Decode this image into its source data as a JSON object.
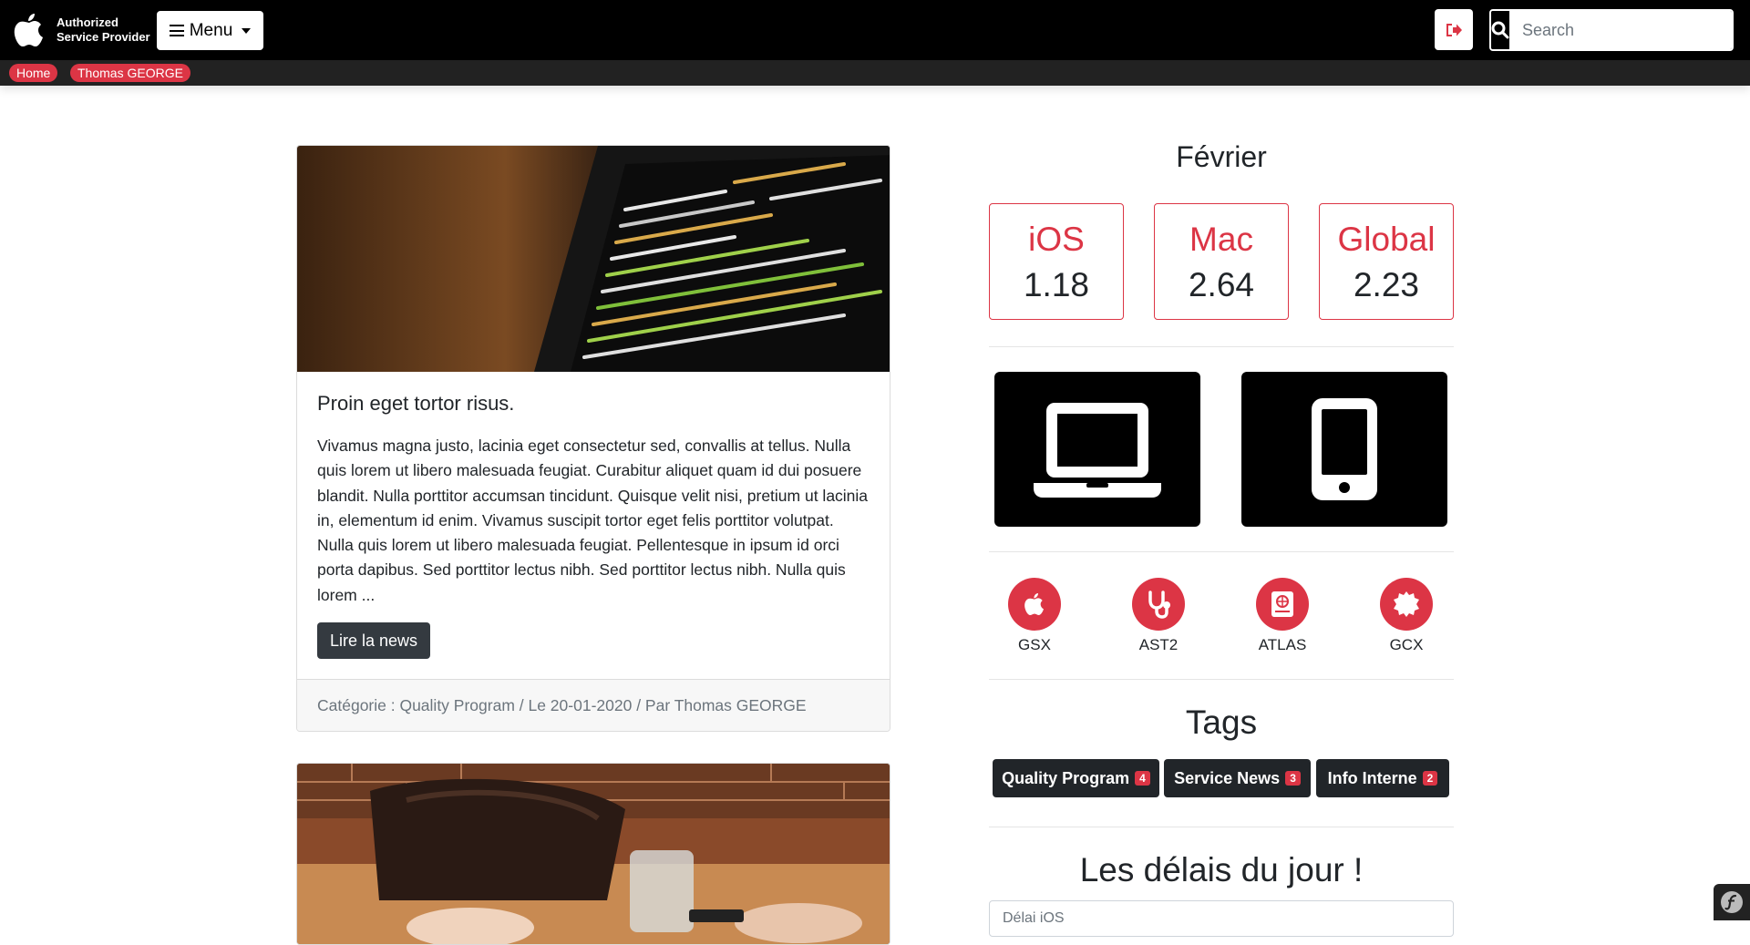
{
  "navbar": {
    "brand_line1": "Authorized",
    "brand_line2": "Service Provider",
    "menu_label": "Menu",
    "search_placeholder": "Search"
  },
  "breadcrumb": [
    "Home",
    "Thomas GEORGE"
  ],
  "news": [
    {
      "title": "Proin eget tortor risus.",
      "excerpt": "Vivamus magna justo, lacinia eget consectetur sed, convallis at tellus. Nulla quis lorem ut libero malesuada feugiat. Curabitur aliquet quam id dui posuere blandit. Nulla porttitor accumsan tincidunt. Quisque velit nisi, pretium ut lacinia in, elementum id enim. Vivamus suscipit tortor eget felis porttitor volutpat. Nulla quis lorem ut libero malesuada feugiat. Pellentesque in ipsum id orci porta dapibus. Sed porttitor lectus nibh. Sed porttitor lectus nibh. Nulla quis lorem ...",
      "button": "Lire la news",
      "footer": "Catégorie : Quality Program / Le 20-01-2020 / Par Thomas GEORGE"
    }
  ],
  "stats": {
    "month": "Février",
    "items": [
      {
        "label": "iOS",
        "value": "1.18"
      },
      {
        "label": "Mac",
        "value": "2.64"
      },
      {
        "label": "Global",
        "value": "2.23"
      }
    ]
  },
  "tools": [
    "GSX",
    "AST2",
    "ATLAS",
    "GCX"
  ],
  "tags": {
    "title": "Tags",
    "items": [
      {
        "label": "Quality Program",
        "count": "4"
      },
      {
        "label": "Service News",
        "count": "3"
      },
      {
        "label": "Info Interne",
        "count": "2"
      }
    ]
  },
  "delays": {
    "title": "Les délais du jour !",
    "field_label": "Délai iOS"
  },
  "colors": {
    "accent": "#dc3545",
    "navbar": "#000000",
    "dark_button": "#343a40"
  }
}
